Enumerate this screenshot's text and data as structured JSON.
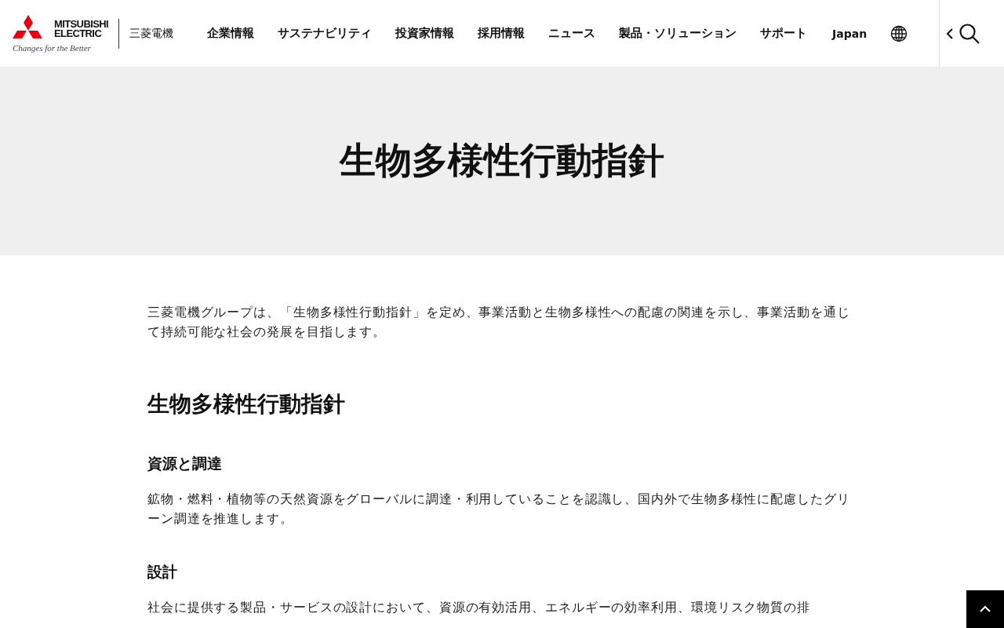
{
  "header": {
    "logo": {
      "brand_line_1": "MITSUBISHI",
      "brand_line_2": "ELECTRIC",
      "tagline": "Changes for the Better",
      "company": "三菱電機"
    },
    "nav": [
      "企業情報",
      "サステナビリティ",
      "投資家情報",
      "採用情報",
      "ニュース",
      "製品・ソリューション",
      "サポート"
    ],
    "region": "Japan"
  },
  "hero": {
    "title": "生物多様性行動指針"
  },
  "intro": "三菱電機グループは、「生物多様性行動指針」を定め、事業活動と生物多様性への配慮の関連を示し、事業活動を通じて持続可能な社会の発展を目指します。",
  "section": {
    "heading": "生物多様性行動指針",
    "items": [
      {
        "heading": "資源と調達",
        "body": "鉱物・燃料・植物等の天然資源をグローバルに調達・利用していることを認識し、国内外で生物多様性に配慮したグリーン調達を推進します。"
      },
      {
        "heading": "設計",
        "body": "社会に提供する製品・サービスの設計において、資源の有効活用、エネルギーの効率利用、環境リスク物質の排"
      }
    ]
  }
}
